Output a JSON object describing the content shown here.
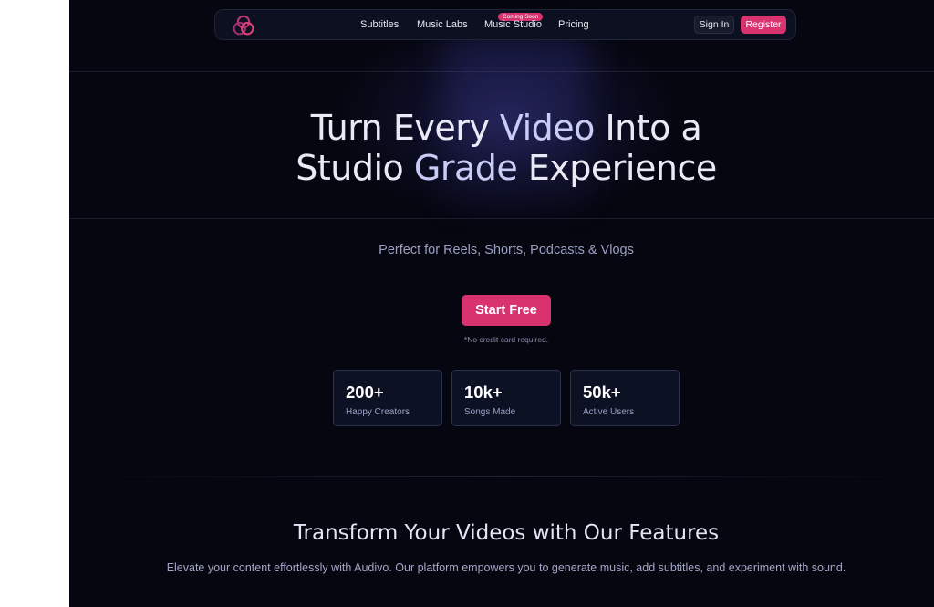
{
  "nav": {
    "logo_icon": "interlocking-rings-logo-icon",
    "links": [
      {
        "label": "Subtitles"
      },
      {
        "label": "Music Labs"
      },
      {
        "label": "Music Studio",
        "badge": "Coming Soon"
      },
      {
        "label": "Pricing"
      }
    ],
    "sign_in_label": "Sign In",
    "register_label": "Register"
  },
  "hero": {
    "title_line1_a": "Turn Every ",
    "title_line1_accent": "Video",
    "title_line1_b": " Into a",
    "title_line2_a": "Studio ",
    "title_line2_accent": "Grade",
    "title_line2_b": " Experience",
    "subtitle": "Perfect for Reels, Shorts, Podcasts & Vlogs",
    "cta_label": "Start Free",
    "cta_note": "*No credit card required."
  },
  "stats": [
    {
      "value": "200+",
      "label": "Happy Creators"
    },
    {
      "value": "10k+",
      "label": "Songs Made"
    },
    {
      "value": "50k+",
      "label": "Active Users"
    }
  ],
  "features": {
    "title": "Transform Your Videos with Our Features",
    "description": "Elevate your content effortlessly with Audivo. Our platform empowers you to generate music, add subtitles, and experiment with sound."
  },
  "colors": {
    "background": "#05060f",
    "accent": "#d8336f",
    "text_muted": "#9aa0c4"
  }
}
